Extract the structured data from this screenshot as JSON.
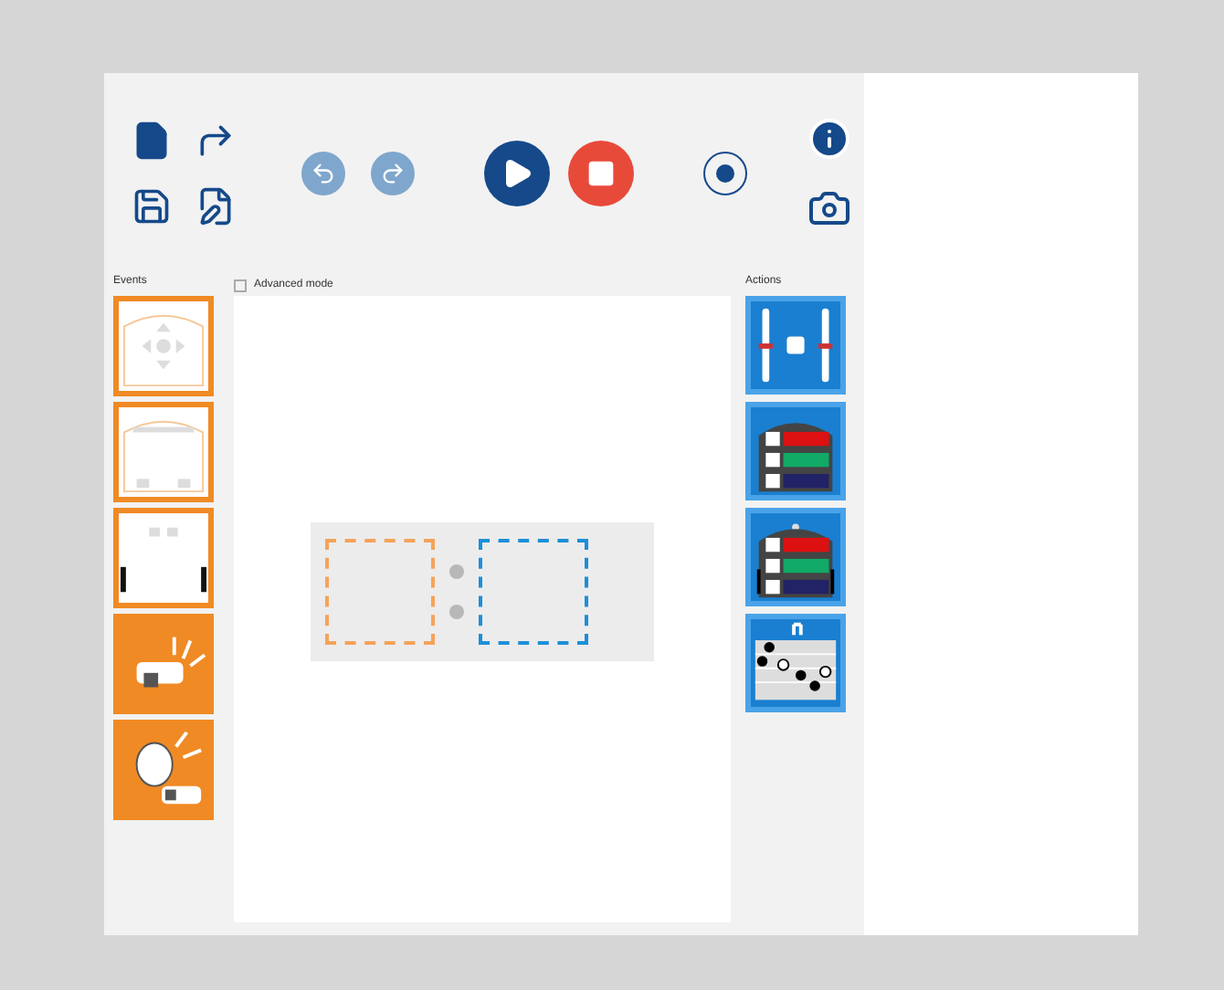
{
  "labels": {
    "events": "Events",
    "actions": "Actions"
  },
  "mode": {
    "label": "Advanced mode",
    "checked": false
  },
  "events": [
    {
      "kind": "buttons"
    },
    {
      "kind": "proximity"
    },
    {
      "kind": "ground"
    },
    {
      "kind": "tap"
    },
    {
      "kind": "clap"
    }
  ],
  "actions": [
    {
      "kind": "motors"
    },
    {
      "kind": "top-color"
    },
    {
      "kind": "bottom-color"
    },
    {
      "kind": "music"
    }
  ]
}
